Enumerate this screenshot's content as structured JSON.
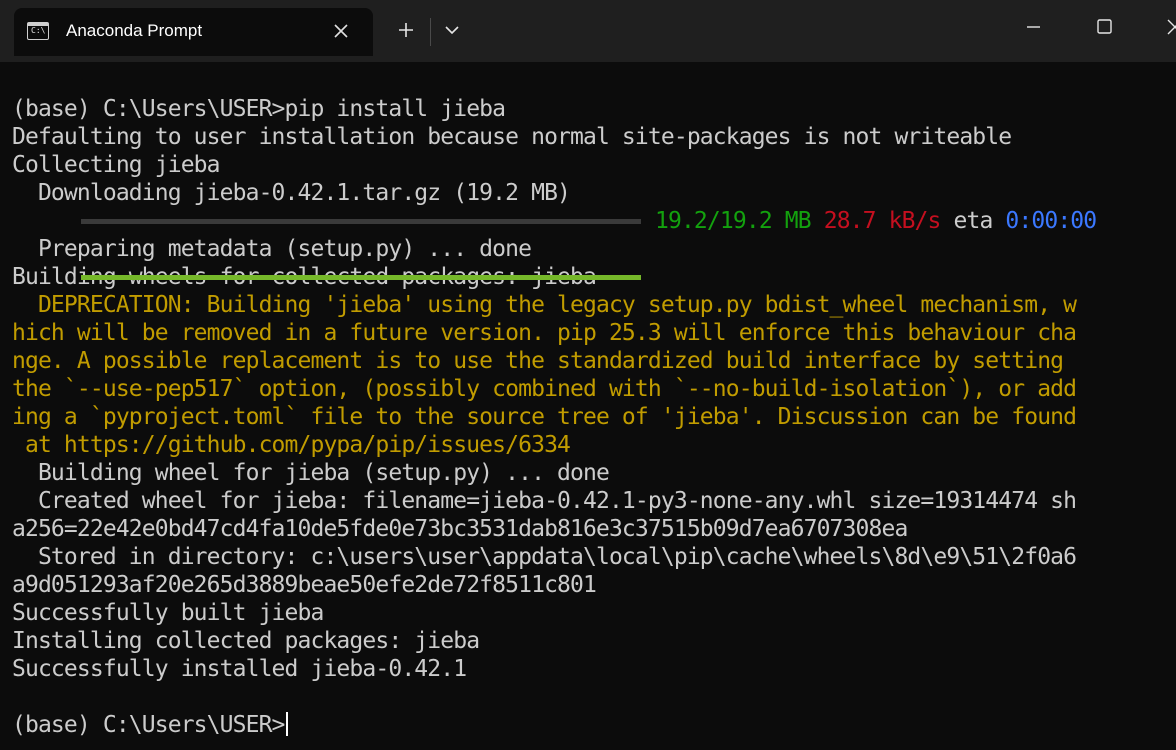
{
  "window": {
    "tab_title": "Anaconda Prompt",
    "tab_icon": "terminal-icon",
    "tab_icon_glyph": "C:\\",
    "new_tab_icon": "plus-icon",
    "dropdown_icon": "chevron-down-icon",
    "minimize_icon": "minimize-icon",
    "maximize_icon": "maximize-icon",
    "close_icon": "close-icon"
  },
  "colors": {
    "background": "#0c0c0c",
    "titlebar": "#1f1f1f",
    "text": "#cccccc",
    "progress_fill": "#76b82a",
    "green": "#13a10e",
    "red": "#c50f1f",
    "blue": "#3b78ff",
    "warning": "#c19c00"
  },
  "console": {
    "lines_before": [
      "(base) C:\\Users\\USER>pip install jieba",
      "Defaulting to user installation because normal site-packages is not writeable",
      "Collecting jieba",
      "  Downloading jieba-0.42.1.tar.gz (19.2 MB)"
    ],
    "progress": {
      "fraction": 1.0,
      "size": "19.2/19.2 MB",
      "speed": "28.7 kB/s",
      "eta_label": "eta",
      "eta": "0:00:00"
    },
    "lines_middle": [
      "  Preparing metadata (setup.py) ... done",
      "Building wheels for collected packages: jieba"
    ],
    "warning_lines": [
      "  DEPRECATION: Building 'jieba' using the legacy setup.py bdist_wheel mechanism, w",
      "hich will be removed in a future version. pip 25.3 will enforce this behaviour cha",
      "nge. A possible replacement is to use the standardized build interface by setting",
      "the `--use-pep517` option, (possibly combined with `--no-build-isolation`), or add",
      "ing a `pyproject.toml` file to the source tree of 'jieba'. Discussion can be found",
      " at https://github.com/pypa/pip/issues/6334"
    ],
    "lines_after": [
      "  Building wheel for jieba (setup.py) ... done",
      "  Created wheel for jieba: filename=jieba-0.42.1-py3-none-any.whl size=19314474 sh",
      "a256=22e42e0bd47cd4fa10de5fde0e73bc3531dab816e3c37515b09d7ea6707308ea",
      "  Stored in directory: c:\\users\\user\\appdata\\local\\pip\\cache\\wheels\\8d\\e9\\51\\2f0a6",
      "a9d051293af20e265d3889beae50efe2de72f8511c801",
      "Successfully built jieba",
      "Installing collected packages: jieba",
      "Successfully installed jieba-0.42.1"
    ],
    "prompt": "(base) C:\\Users\\USER>"
  }
}
